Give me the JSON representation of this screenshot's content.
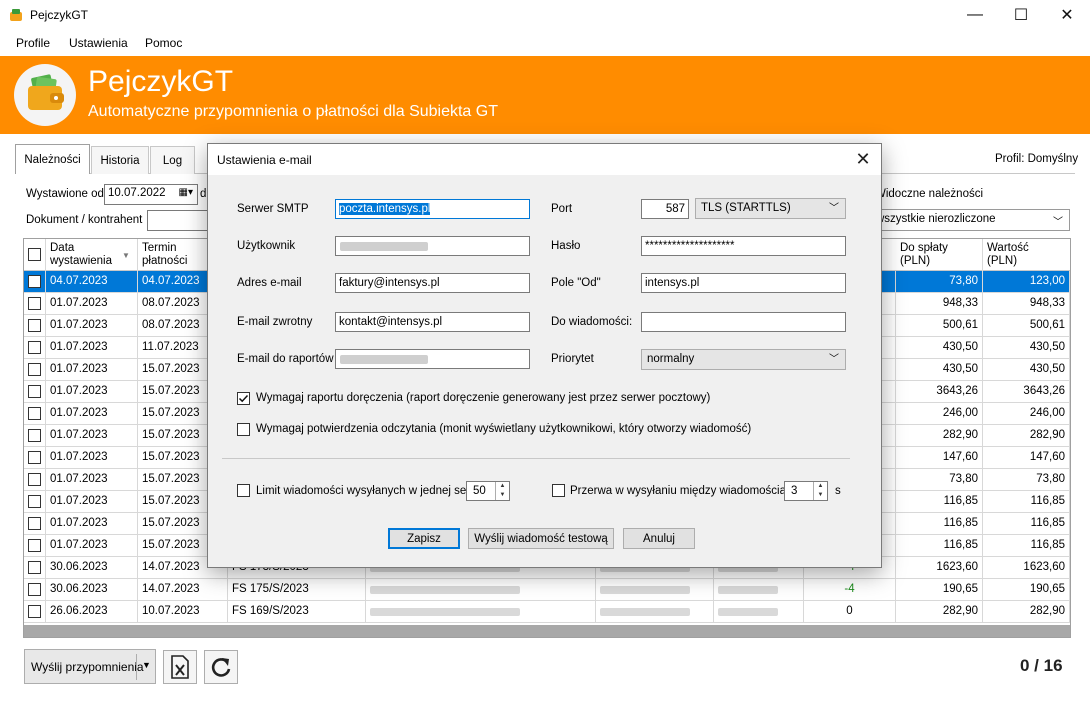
{
  "window": {
    "title": "PejczykGT",
    "minimize": "—",
    "maximize": "☐",
    "close": "✕"
  },
  "menu": [
    "Profile",
    "Ustawienia",
    "Pomoc"
  ],
  "header": {
    "name": "PejczykGT",
    "tagline": "Automatyczne przypomnienia o płatności dla  Subiekta GT",
    "accent": "#ff8c00"
  },
  "tabs": [
    "Należności",
    "Historia",
    "Log"
  ],
  "profile_label": "Profil: Domyślny",
  "filters": {
    "issued_from_label": "Wystawione od",
    "issued_from_value": "10.07.2022",
    "issued_to_partial": "d",
    "document_label": "Dokument / kontrahent",
    "visible_label": "Widoczne należności",
    "visible_value": "wszystkie nierozliczone"
  },
  "grid": {
    "headers": {
      "issue_date": "Data\nwystawienia",
      "due_date": "Termin\npłatności",
      "to_pay": "Do spłaty\n(PLN)",
      "value": "Wartość\n(PLN)"
    },
    "rows": [
      {
        "issue": "04.07.2023",
        "due": "04.07.2023",
        "doc": "",
        "days": "",
        "to_pay": "73,80",
        "value": "123,00"
      },
      {
        "issue": "01.07.2023",
        "due": "08.07.2023",
        "doc": "",
        "days": "",
        "to_pay": "948,33",
        "value": "948,33"
      },
      {
        "issue": "01.07.2023",
        "due": "08.07.2023",
        "doc": "",
        "days": "",
        "to_pay": "500,61",
        "value": "500,61"
      },
      {
        "issue": "01.07.2023",
        "due": "11.07.2023",
        "doc": "",
        "days": "",
        "to_pay": "430,50",
        "value": "430,50"
      },
      {
        "issue": "01.07.2023",
        "due": "15.07.2023",
        "doc": "",
        "days": "",
        "to_pay": "430,50",
        "value": "430,50"
      },
      {
        "issue": "01.07.2023",
        "due": "15.07.2023",
        "doc": "",
        "days": "",
        "to_pay": "3643,26",
        "value": "3643,26"
      },
      {
        "issue": "01.07.2023",
        "due": "15.07.2023",
        "doc": "",
        "days": "",
        "to_pay": "246,00",
        "value": "246,00"
      },
      {
        "issue": "01.07.2023",
        "due": "15.07.2023",
        "doc": "",
        "days": "",
        "to_pay": "282,90",
        "value": "282,90"
      },
      {
        "issue": "01.07.2023",
        "due": "15.07.2023",
        "doc": "",
        "days": "",
        "to_pay": "147,60",
        "value": "147,60"
      },
      {
        "issue": "01.07.2023",
        "due": "15.07.2023",
        "doc": "",
        "days": "",
        "to_pay": "73,80",
        "value": "73,80"
      },
      {
        "issue": "01.07.2023",
        "due": "15.07.2023",
        "doc": "",
        "days": "",
        "to_pay": "116,85",
        "value": "116,85"
      },
      {
        "issue": "01.07.2023",
        "due": "15.07.2023",
        "doc": "",
        "days": "",
        "to_pay": "116,85",
        "value": "116,85"
      },
      {
        "issue": "01.07.2023",
        "due": "15.07.2023",
        "doc": "",
        "days": "",
        "to_pay": "116,85",
        "value": "116,85"
      },
      {
        "issue": "30.06.2023",
        "due": "14.07.2023",
        "doc": "FS 173/S/2023",
        "days": "-4",
        "to_pay": "1623,60",
        "value": "1623,60"
      },
      {
        "issue": "30.06.2023",
        "due": "14.07.2023",
        "doc": "FS 175/S/2023",
        "days": "-4",
        "to_pay": "190,65",
        "value": "190,65"
      },
      {
        "issue": "26.06.2023",
        "due": "10.07.2023",
        "doc": "FS 169/S/2023",
        "days": "0",
        "to_pay": "282,90",
        "value": "282,90"
      }
    ]
  },
  "toolbar": {
    "send_label": "Wyślij przypomnienia",
    "counter": "0 / 16"
  },
  "dialog": {
    "title": "Ustawienia e-mail",
    "smtp_label": "Serwer SMTP",
    "smtp_value": "poczta.intensys.pl",
    "port_label": "Port",
    "port_value": "587",
    "security_value": "TLS (STARTTLS)",
    "user_label": "Użytkownik",
    "password_label": "Hasło",
    "password_value": "********************",
    "email_label": "Adres e-mail",
    "email_value": "faktury@intensys.pl",
    "from_label": "Pole \"Od\"",
    "from_value": "intensys.pl",
    "reply_label": "E-mail zwrotny",
    "reply_value": "kontakt@intensys.pl",
    "bcc_label": "Do wiadomości:",
    "reports_label": "E-mail do raportów",
    "priority_label": "Priorytet",
    "priority_value": "normalny",
    "delivery_receipt": "Wymagaj raportu doręczenia (raport doręczenie generowany jest przez serwer pocztowy)",
    "delivery_receipt_checked": true,
    "read_receipt": "Wymagaj potwierdzenia odczytania (monit wyświetlany użytkownikowi, który otworzy wiadomość)",
    "read_receipt_checked": false,
    "limit_label": "Limit wiadomości wysyłanych w jednej sesji",
    "limit_value": "50",
    "pause_label": "Przerwa w wysyłaniu między wiadomościami",
    "pause_value": "3",
    "pause_unit": "s",
    "save": "Zapisz",
    "test": "Wyślij wiadomość testową",
    "cancel": "Anuluj"
  }
}
